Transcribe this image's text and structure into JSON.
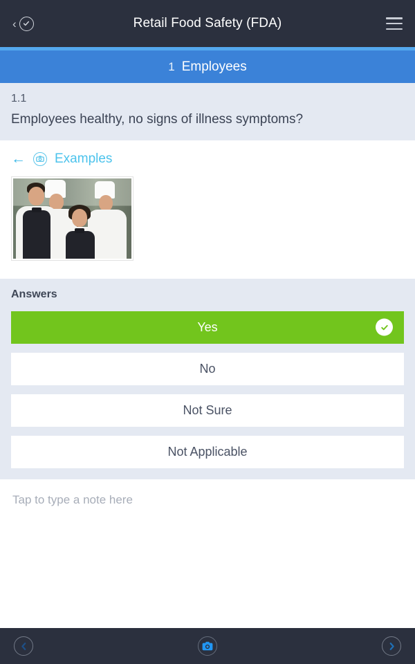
{
  "appbar": {
    "back_chevron": "‹",
    "back_icon_name": "circle-check-icon",
    "title": "Retail Food Safety (FDA)",
    "menu_icon_name": "hamburger-menu-icon"
  },
  "section": {
    "number": "1",
    "label": "Employees"
  },
  "question": {
    "number": "1.1",
    "text": "Employees healthy, no signs of illness symptoms?"
  },
  "media": {
    "back_arrow": "←",
    "badge_icon_name": "photo-circle-icon",
    "examples_label": "Examples",
    "image_alt": "Restaurant staff: chefs and waiters in a kitchen"
  },
  "answers": {
    "title": "Answers",
    "options": [
      {
        "label": "Yes",
        "selected": true
      },
      {
        "label": "No",
        "selected": false
      },
      {
        "label": "Not Sure",
        "selected": false
      },
      {
        "label": "Not Applicable",
        "selected": false
      }
    ]
  },
  "note": {
    "placeholder": "Tap to type a note here",
    "value": ""
  },
  "bottombar": {
    "prev_label": "‹",
    "camera_icon_name": "camera-icon",
    "next_label": "›"
  },
  "colors": {
    "appbar_bg": "#2b303e",
    "section_band": "#3b82d8",
    "section_accent": "#54a8ee",
    "panel_bg": "#e4e9f2",
    "selected_green": "#72c51d",
    "examples_cyan": "#4cc3ec",
    "camera_blue": "#2196f3"
  }
}
